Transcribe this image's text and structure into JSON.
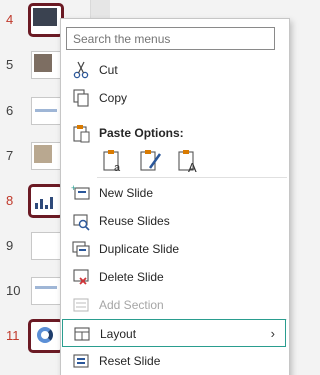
{
  "slides": [
    {
      "number": "4",
      "selected": true
    },
    {
      "number": "5",
      "selected": false
    },
    {
      "number": "6",
      "selected": false
    },
    {
      "number": "7",
      "selected": false
    },
    {
      "number": "8",
      "selected": true
    },
    {
      "number": "9",
      "selected": false
    },
    {
      "number": "10",
      "selected": false
    },
    {
      "number": "11",
      "selected": true
    }
  ],
  "menu": {
    "search_placeholder": "Search the menus",
    "cut": "Cut",
    "copy": "Copy",
    "paste_options": "Paste Options:",
    "paste_icons": [
      "paste-keep-source-icon",
      "paste-picture-icon",
      "paste-keep-text-icon"
    ],
    "new_slide": "New Slide",
    "reuse_slides": "Reuse Slides",
    "duplicate_slide": "Duplicate Slide",
    "delete_slide": "Delete Slide",
    "add_section": "Add Section",
    "layout": "Layout",
    "reset_slide": "Reset Slide"
  },
  "colors": {
    "highlight_border": "#2a9d8f",
    "selected_thumb_border": "#6b1a24",
    "selected_number": "#c0392b",
    "icon_accent": "#d97a00",
    "icon_blue": "#2b579a"
  }
}
